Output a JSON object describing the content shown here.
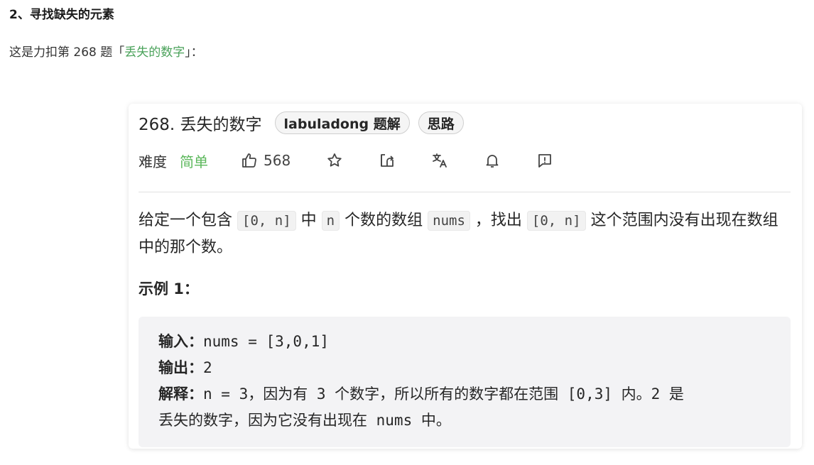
{
  "section_heading": "2、寻找缺失的元素",
  "intro": {
    "prefix": "这是力扣第 268 题",
    "bracket_open": "「",
    "link_text": "丢失的数字",
    "bracket_close": "」：",
    "link_color": "#4aa25a"
  },
  "card": {
    "title": "268. 丢失的数字",
    "tags": [
      "labuladong 题解",
      "思路"
    ],
    "difficulty_label": "难度",
    "difficulty_value": "简单",
    "difficulty_color": "#5cb85c",
    "likes": "568",
    "toolbar_icons": [
      "thumbs-up-icon",
      "star-icon",
      "share-icon",
      "translate-icon",
      "bell-icon",
      "feedback-icon"
    ]
  },
  "description": {
    "p1": "给定一个包含",
    "c1": "[0, n]",
    "p2": "中",
    "c2": "n",
    "p3": "个数的数组",
    "c3": "nums",
    "p4": "，找出",
    "c4": "[0, n]",
    "p5": "这个范围内没有出现在数组中的那个数。"
  },
  "example": {
    "title": "示例 1：",
    "input_label": "输入：",
    "input_value": "nums = [3,0,1]",
    "output_label": "输出：",
    "output_value": "2",
    "explain_label": "解释：",
    "explain_line1": "n = 3，因为有 3 个数字，所以所有的数字都在范围 [0,3] 内。2 是",
    "explain_line2": "丢失的数字，因为它没有出现在 nums 中。"
  }
}
